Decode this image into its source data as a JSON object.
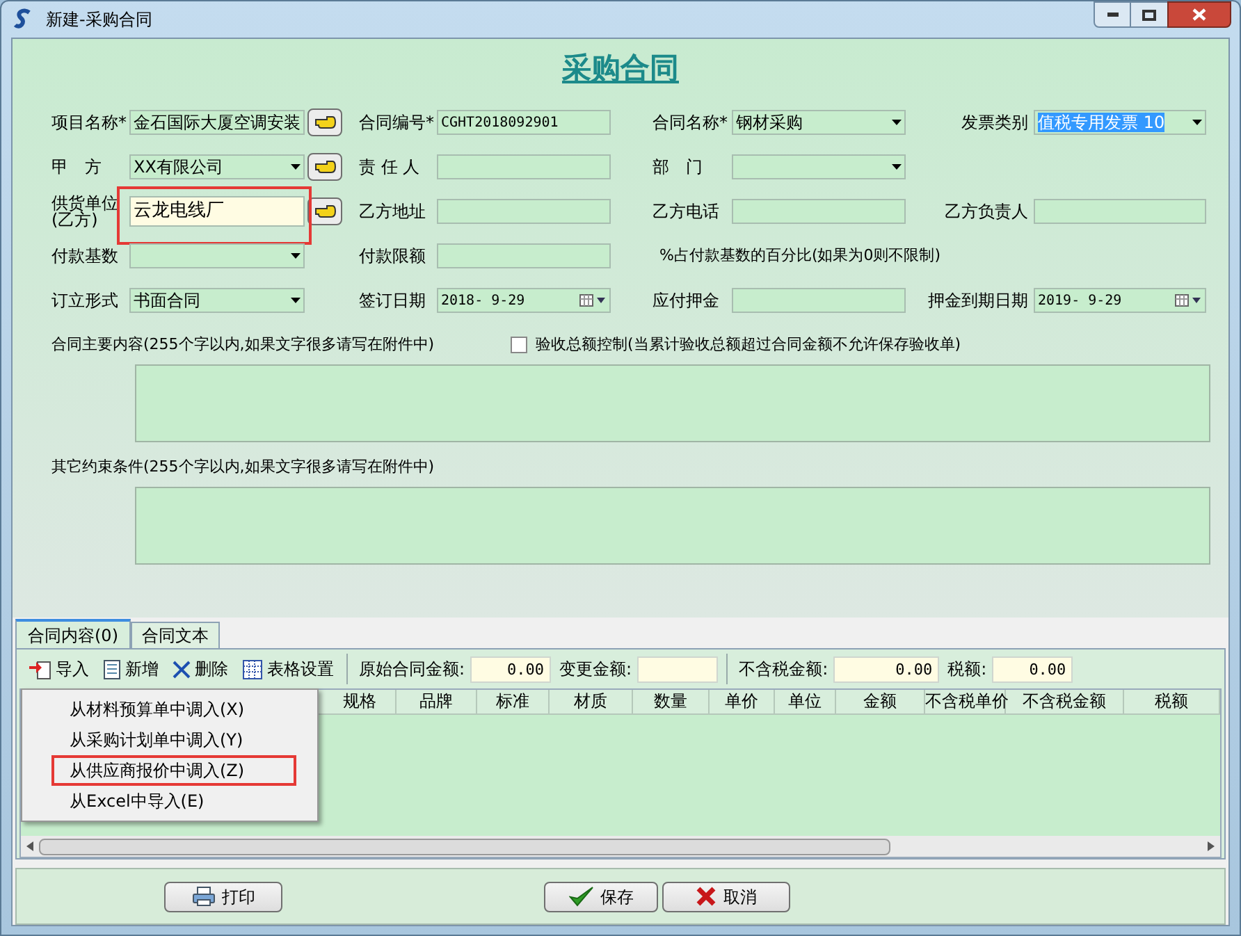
{
  "window": {
    "title": "新建-采购合同"
  },
  "heading": "采购合同",
  "form_rows": [
    {
      "items": [
        {
          "kind": "lookup",
          "label": "项目名称*",
          "value": "金石国际大厦空调安装",
          "highlighted": false
        },
        {
          "kind": "text",
          "label": "合同编号*",
          "value": "CGHT2018092901"
        },
        {
          "kind": "combo",
          "label": "合同名称*",
          "value": "钢材采购"
        },
        {
          "kind": "combo",
          "label": "发票类别",
          "value": "值税专用发票 10",
          "selected": true
        }
      ]
    },
    {
      "items": [
        {
          "kind": "combo_lookup",
          "label": "甲　方",
          "value": "XX有限公司"
        },
        {
          "kind": "text",
          "label": "责 任 人"
        },
        {
          "kind": "combo",
          "label": "部　门"
        }
      ]
    },
    {
      "items": [
        {
          "kind": "lookup",
          "label": "供货单位\n(乙方)",
          "value": "云龙电线厂",
          "highlighted": true
        },
        {
          "kind": "text",
          "label": "乙方地址"
        },
        {
          "kind": "text",
          "label": "乙方电话"
        },
        {
          "kind": "text",
          "label": "乙方负责人"
        }
      ]
    },
    {
      "items": [
        {
          "kind": "combo",
          "label": "付款基数"
        },
        {
          "kind": "text",
          "label": "付款限额"
        },
        {
          "kind": "note",
          "label": "%占付款基数的百分比(如果为0则不限制)"
        }
      ]
    },
    {
      "items": [
        {
          "kind": "combo",
          "label": "订立形式",
          "value": "书面合同"
        },
        {
          "kind": "date",
          "label": "签订日期",
          "value": "2018- 9-29"
        },
        {
          "kind": "text",
          "label": "应付押金"
        },
        {
          "kind": "date",
          "label": "押金到期日期",
          "value": "2019- 9-29"
        }
      ]
    }
  ],
  "main_content": {
    "label": "合同主要内容(255个字以内,如果文字很多请写在附件中)",
    "checkbox": {
      "label": "验收总额控制(当累计验收总额超过合同金额不允许保存验收单)",
      "checked": false
    }
  },
  "other_terms": {
    "label": "其它约束条件(255个字以内,如果文字很多请写在附件中)"
  },
  "tabs": [
    {
      "label": "合同内容(0)",
      "selected": true
    },
    {
      "label": "合同文本",
      "selected": false
    }
  ],
  "toolbar": {
    "buttons": [
      {
        "kind": "import",
        "label": "导入"
      },
      {
        "kind": "add",
        "label": "新增"
      },
      {
        "kind": "delete",
        "label": "删除"
      },
      {
        "kind": "settings",
        "label": "表格设置"
      }
    ],
    "amounts": [
      {
        "label": "原始合同金额:",
        "value": "0.00"
      },
      {
        "label": "变更金额:"
      },
      {
        "label": "不含税金额:",
        "value": "0.00"
      },
      {
        "label": "税额:",
        "value": "0.00"
      }
    ]
  },
  "table": {
    "columns": [
      "规格",
      "品牌",
      "标准",
      "材质",
      "数量",
      "单价",
      "单位",
      "金额",
      "不含税单价",
      "不含税金额",
      "税额"
    ]
  },
  "import_menu": [
    {
      "label": "从材料预算单中调入(X)",
      "highlighted": false
    },
    {
      "label": "从采购计划单中调入(Y)",
      "highlighted": false
    },
    {
      "label": "从供应商报价中调入(Z)",
      "highlighted": true
    },
    {
      "label": "从Excel中导入(E)",
      "highlighted": false
    }
  ],
  "buttons": [
    {
      "kind": "print",
      "label": "打印"
    },
    {
      "kind": "save",
      "label": "保存"
    },
    {
      "kind": "cancel",
      "label": "取消"
    }
  ]
}
